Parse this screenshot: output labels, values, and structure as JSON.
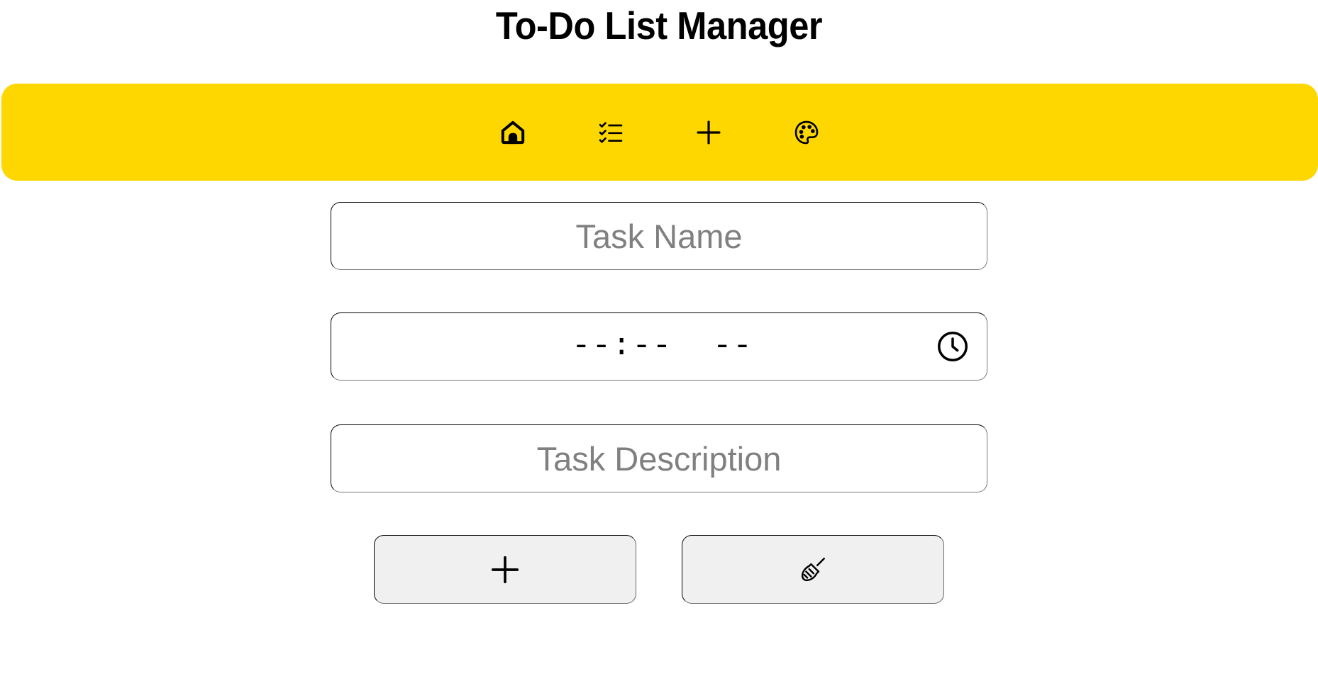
{
  "app": {
    "title": "To-Do List Manager"
  },
  "colors": {
    "navbar_background": "#FFD700",
    "button_background": "#F0F0F0",
    "placeholder_text": "#808080"
  },
  "navbar": {
    "items": [
      {
        "icon": "home-icon"
      },
      {
        "icon": "checklist-icon"
      },
      {
        "icon": "plus-icon"
      },
      {
        "icon": "palette-icon"
      }
    ]
  },
  "form": {
    "task_name": {
      "value": "",
      "placeholder": "Task Name"
    },
    "task_time": {
      "value": "--:--  --",
      "icon": "clock-icon"
    },
    "task_description": {
      "value": "",
      "placeholder": "Task Description"
    }
  },
  "actions": {
    "add_icon": "plus-icon",
    "clear_icon": "broom-icon"
  }
}
